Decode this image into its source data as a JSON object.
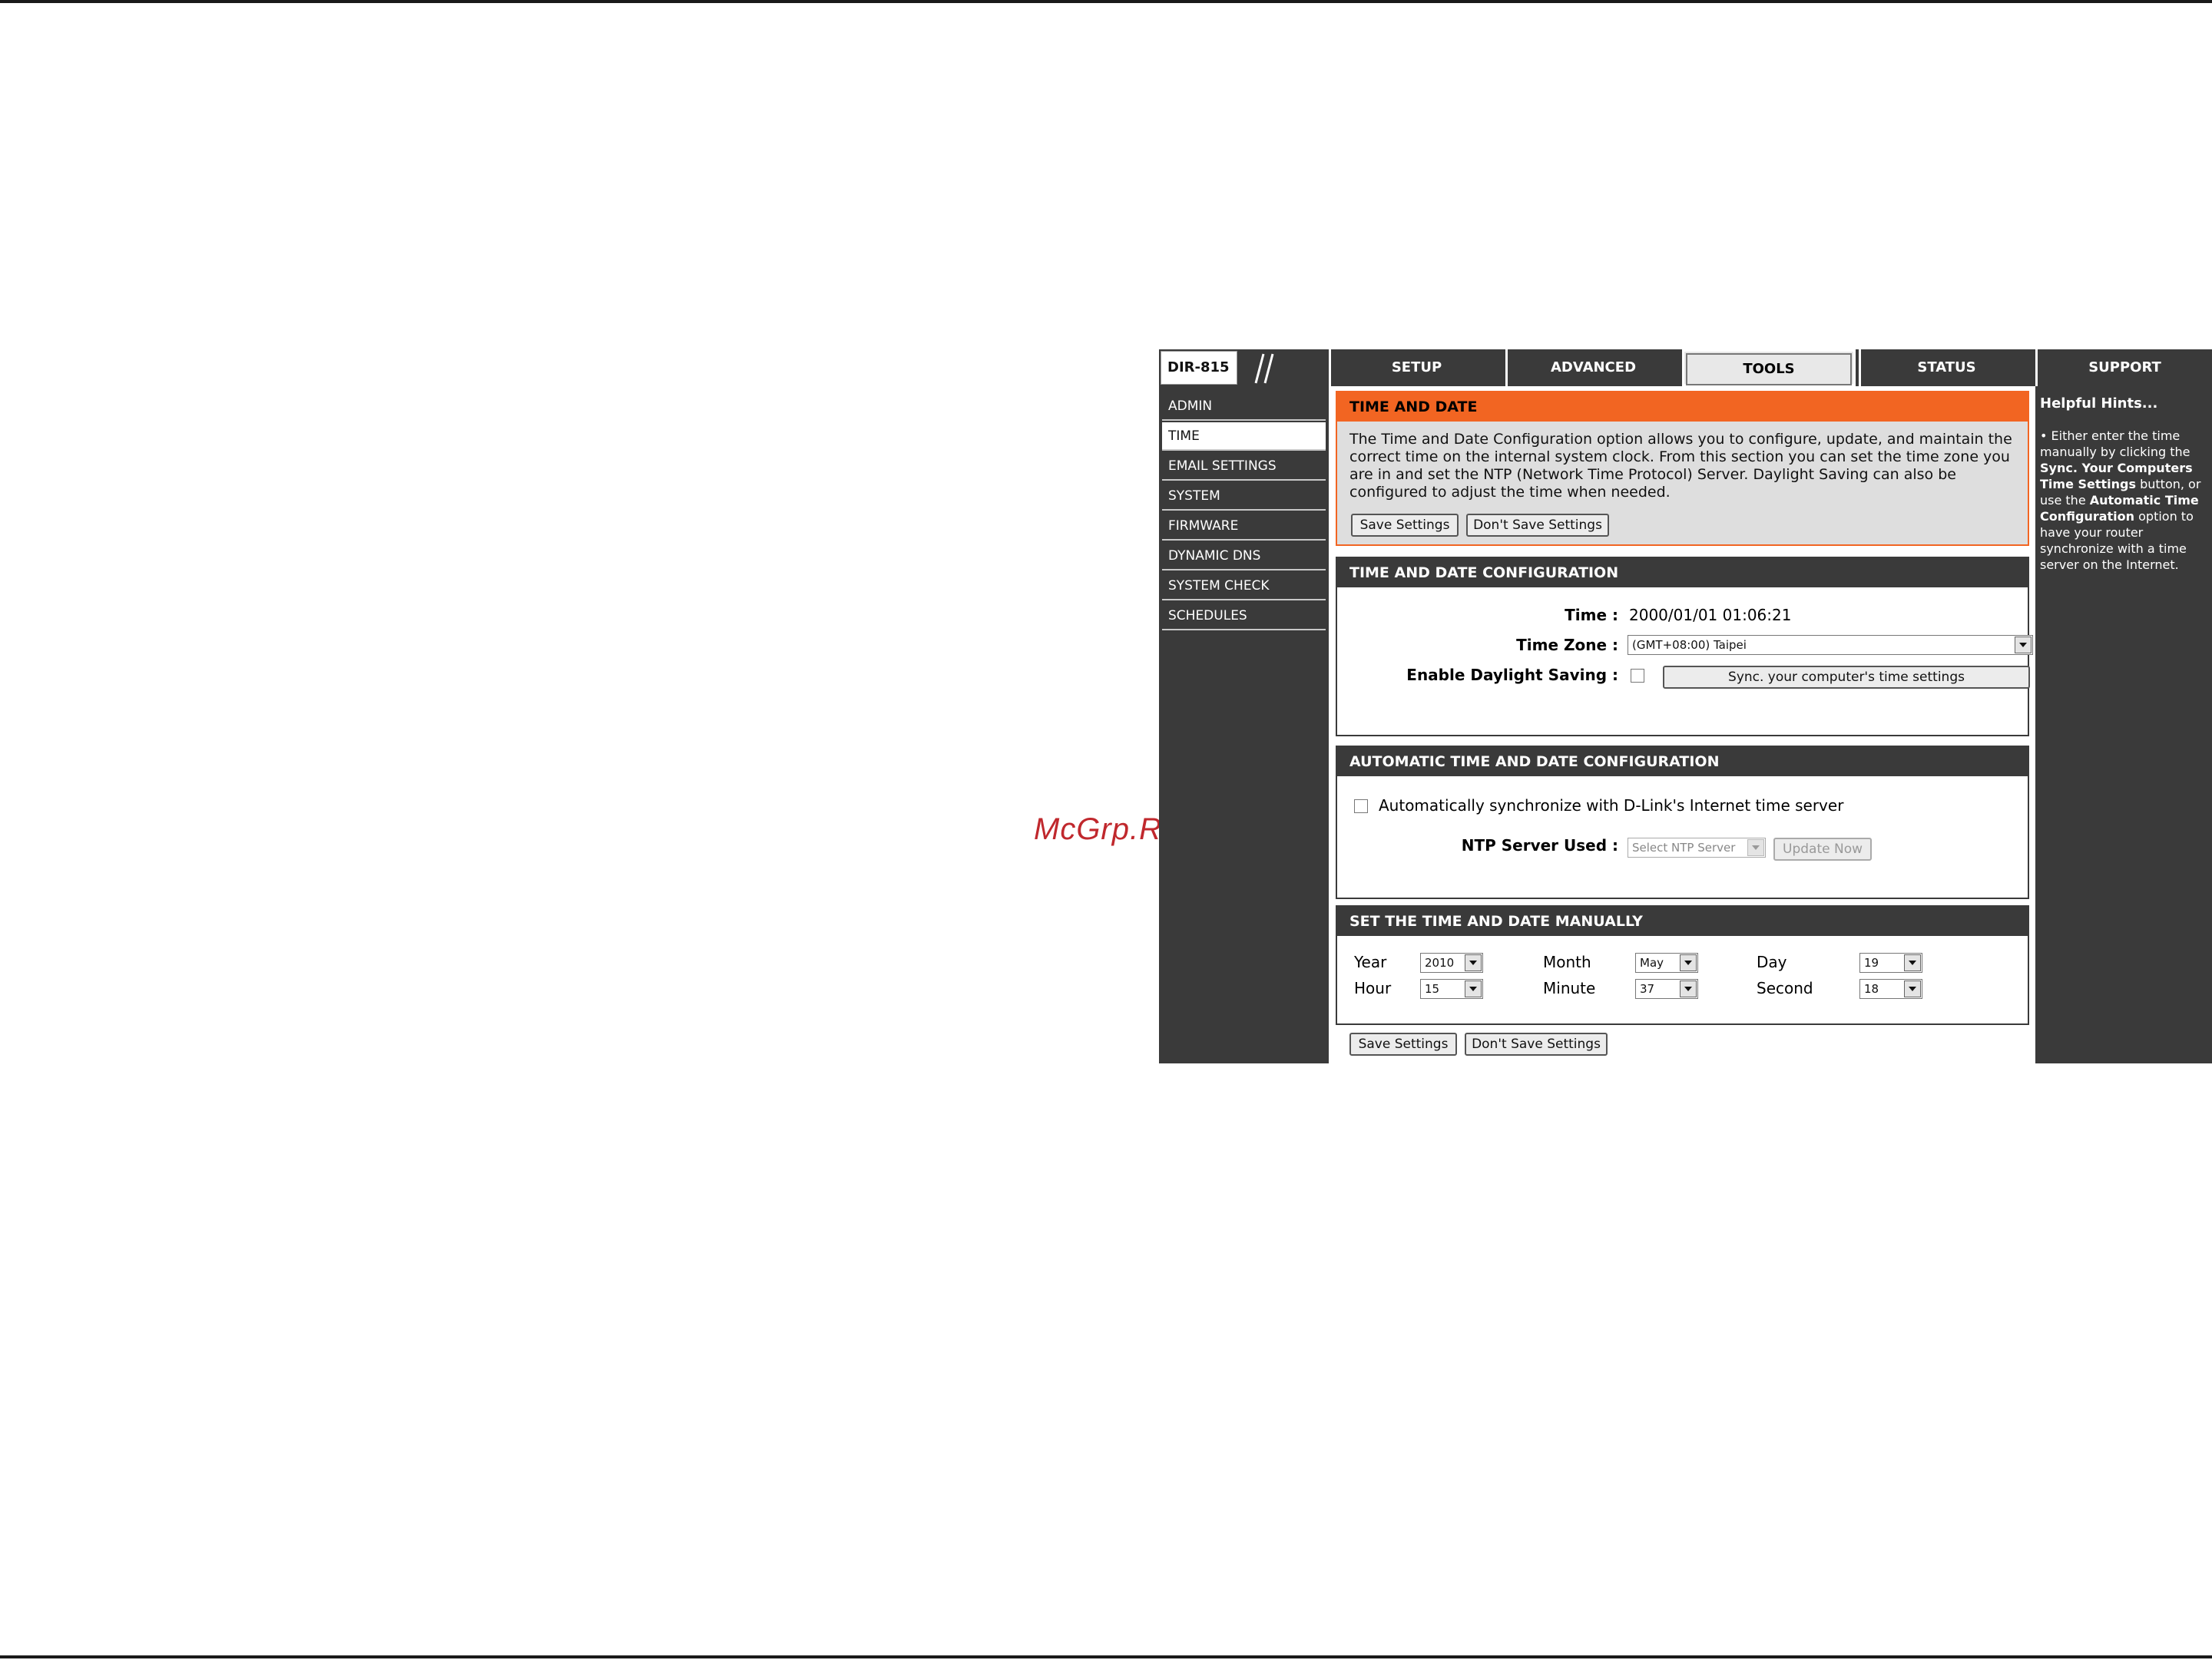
{
  "watermark": "McGrp.Ru",
  "header": {
    "model": "DIR-815",
    "tabs": [
      {
        "label": "SETUP"
      },
      {
        "label": "ADVANCED"
      },
      {
        "label": "TOOLS"
      },
      {
        "label": "STATUS"
      },
      {
        "label": "SUPPORT"
      }
    ],
    "active_tab": "TOOLS"
  },
  "sidebar": {
    "items": [
      {
        "label": "ADMIN"
      },
      {
        "label": "TIME"
      },
      {
        "label": "EMAIL SETTINGS"
      },
      {
        "label": "SYSTEM"
      },
      {
        "label": "FIRMWARE"
      },
      {
        "label": "DYNAMIC DNS"
      },
      {
        "label": "SYSTEM CHECK"
      },
      {
        "label": "SCHEDULES"
      }
    ],
    "active_item": "TIME"
  },
  "intro": {
    "title": "TIME AND DATE",
    "description": "The Time and Date Configuration option allows you to configure, update, and maintain the correct time on the internal system clock. From this section you can set the time zone you are in and set the NTP (Network Time Protocol) Server. Daylight Saving can also be configured to adjust the time when needed.",
    "save_label": "Save Settings",
    "dont_save_label": "Don't Save Settings"
  },
  "config": {
    "title": "TIME AND DATE CONFIGURATION",
    "time_label": "Time :",
    "time_value": "2000/01/01 01:06:21",
    "timezone_label": "Time Zone :",
    "timezone_value": "(GMT+08:00) Taipei",
    "daylight_label": "Enable Daylight Saving :",
    "sync_button": "Sync. your computer's time settings"
  },
  "auto": {
    "title": "AUTOMATIC TIME AND DATE CONFIGURATION",
    "auto_sync_label": "Automatically synchronize with D-Link's Internet time server",
    "ntp_label": "NTP Server Used :",
    "ntp_placeholder": "Select NTP Server",
    "update_button": "Update Now"
  },
  "manual": {
    "title": "SET THE TIME AND DATE MANUALLY",
    "year_label": "Year",
    "year_value": "2010",
    "month_label": "Month",
    "month_value": "May",
    "day_label": "Day",
    "day_value": "19",
    "hour_label": "Hour",
    "hour_value": "15",
    "minute_label": "Minute",
    "minute_value": "37",
    "second_label": "Second",
    "second_value": "18"
  },
  "footer": {
    "save_label": "Save Settings",
    "dont_save_label": "Don't Save Settings"
  },
  "hints": {
    "title": "Helpful Hints...",
    "bullet": "•",
    "t1": " Either enter the time manually by clicking the ",
    "b1": "Sync. Your Computers Time Settings",
    "t2": " button, or use the ",
    "b2": "Automatic Time Configuration",
    "t3": " option to have your router synchronize with a time server on the Internet."
  }
}
